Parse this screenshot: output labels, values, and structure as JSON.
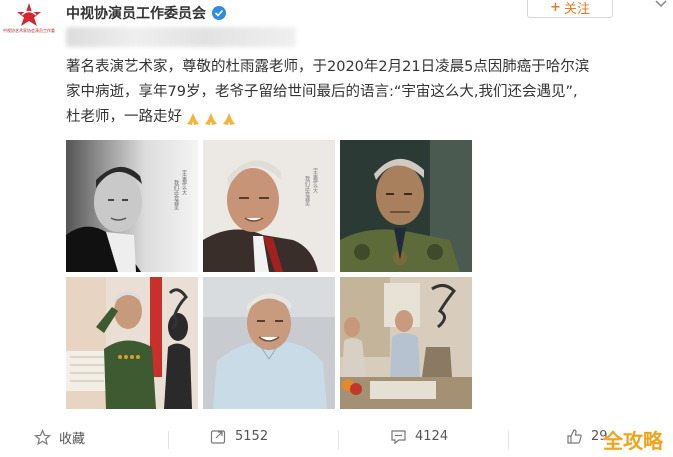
{
  "account": {
    "name": "中视协演员工作委员会",
    "logo_text": "中视协艺术家协会演员工作委"
  },
  "follow_button": {
    "icon": "plus-icon",
    "label": "关注"
  },
  "post": {
    "lines": [
      "著名表演艺术家，尊敬的杜雨露老师，于2020年2月21日凌晨5点因肺癌于哈尔滨",
      "家中病逝，享年79岁，老爷子留给世间最后的语言:“宇宙这么大,我们还会遇见”,",
      "杜老师，一路走好"
    ],
    "emoji": [
      "folded-hands",
      "folded-hands",
      "folded-hands"
    ]
  },
  "photos": [
    {
      "name": "photo-bw-portrait",
      "caption": "宇宙那么大 我们还会遇见"
    },
    {
      "name": "photo-color-portrait",
      "caption": "宇宙那么大 我们还会遇见"
    },
    {
      "name": "photo-camouflage-uniform",
      "caption": ""
    },
    {
      "name": "photo-salute-uniform",
      "caption": ""
    },
    {
      "name": "photo-smiling-blue-shirt",
      "caption": ""
    },
    {
      "name": "photo-living-room-scene",
      "caption": ""
    }
  ],
  "actions": {
    "favorite": {
      "icon": "star-icon",
      "label": "收藏"
    },
    "repost": {
      "icon": "repost-icon",
      "count": "5152"
    },
    "comment": {
      "icon": "comment-icon",
      "count": "4124"
    },
    "like": {
      "icon": "thumb-up-icon",
      "count": "29..."
    }
  },
  "watermark": "全攻略",
  "colors": {
    "accent": "#e77a22",
    "text": "#333333",
    "muted": "#555555",
    "watermark": "#f2a31b"
  }
}
